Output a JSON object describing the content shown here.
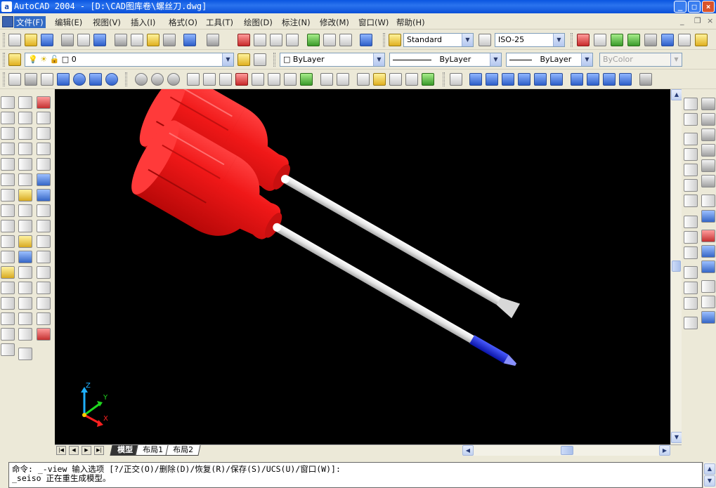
{
  "window": {
    "title": "AutoCAD 2004 - [D:\\CAD图库卷\\螺丝刀.dwg]",
    "app_letter": "a",
    "min": "_",
    "max": "□",
    "close": "×"
  },
  "menu": {
    "items": [
      "文件(F)",
      "编辑(E)",
      "视图(V)",
      "插入(I)",
      "格式(O)",
      "工具(T)",
      "绘图(D)",
      "标注(N)",
      "修改(M)",
      "窗口(W)",
      "帮助(H)"
    ],
    "mdi_min": "_",
    "mdi_restore": "❐",
    "mdi_close": "×"
  },
  "toolbar_standard": {
    "text_style": "Standard",
    "dim_style": "ISO-25"
  },
  "toolbar_layers": {
    "layer_name": "0",
    "color": "ByLayer",
    "linetype": "ByLayer",
    "lineweight": "ByLayer",
    "plot_style": "ByColor"
  },
  "ucs": {
    "z": "Z",
    "y": "Y",
    "x": "X"
  },
  "tabs": {
    "model": "模型",
    "layout1": "布局1",
    "layout2": "布局2"
  },
  "command": {
    "line1": "命令: _-view 输入选项 [?/正交(O)/删除(D)/恢复(R)/保存(S)/UCS(U)/窗口(W)]:",
    "line2": "_seiso 正在重生成模型。"
  },
  "colors": {
    "handle": "#e8191c",
    "shaft": "#f2f2f2",
    "tip_blue": "#1a2ad8",
    "canvas": "#000000",
    "titlebar": "#0a55e0"
  }
}
